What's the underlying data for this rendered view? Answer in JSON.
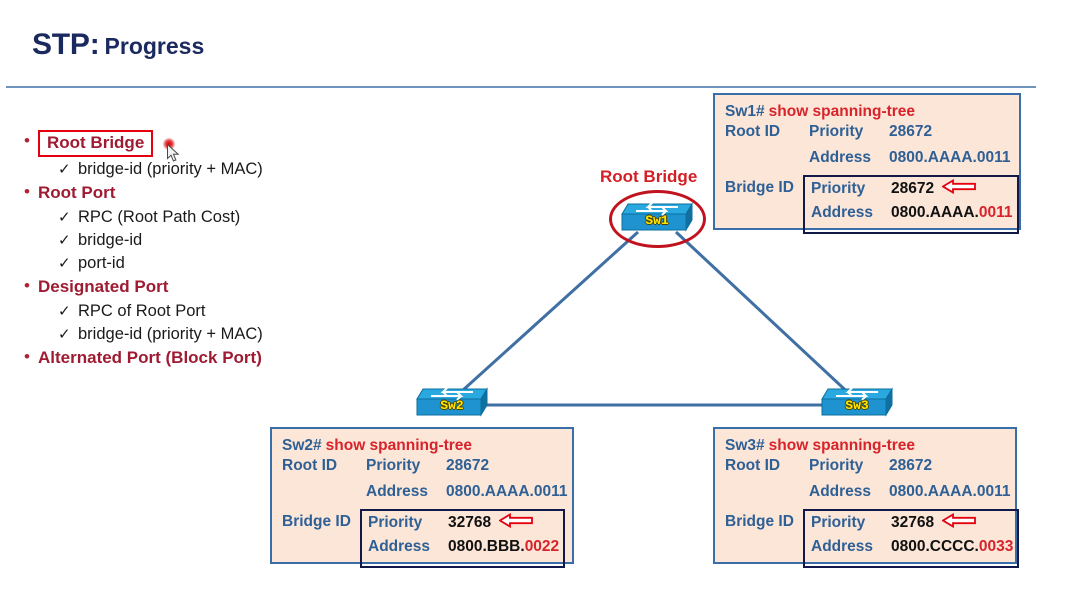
{
  "slide": {
    "title_main": "STP:",
    "title_sub": "Progress"
  },
  "bullets": [
    {
      "kind": "level1",
      "text": "Root Bridge",
      "boxed": true
    },
    {
      "kind": "level2",
      "text": "bridge-id (priority + MAC)"
    },
    {
      "kind": "level1",
      "text": "Root Port",
      "boxed": false
    },
    {
      "kind": "level2",
      "text": "RPC (Root Path Cost)"
    },
    {
      "kind": "level2",
      "text": "bridge-id"
    },
    {
      "kind": "level2",
      "text": "port-id"
    },
    {
      "kind": "level1",
      "text": "Designated Port",
      "boxed": false
    },
    {
      "kind": "level2",
      "text": "RPC of Root Port"
    },
    {
      "kind": "level2",
      "text": "bridge-id (priority + MAC)"
    },
    {
      "kind": "level1",
      "text": "Alternated Port (Block Port)",
      "boxed": false
    }
  ],
  "topology": {
    "root_bridge_label": "Root Bridge",
    "switches": [
      {
        "name": "Sw1"
      },
      {
        "name": "Sw2"
      },
      {
        "name": "Sw3"
      }
    ]
  },
  "panels": {
    "sw1": {
      "host": "Sw1#",
      "command": "show spanning-tree",
      "root_id_label": "Root ID",
      "bridge_id_label": "Bridge ID",
      "priority_label": "Priority",
      "address_label": "Address",
      "root_priority": "28672",
      "root_address": "0800.AAAA.0011",
      "bridge_priority": "28672",
      "bridge_address_main": "0800.AAAA.",
      "bridge_address_hl": "0011"
    },
    "sw2": {
      "host": "Sw2#",
      "command": "show spanning-tree",
      "root_id_label": "Root ID",
      "bridge_id_label": "Bridge ID",
      "priority_label": "Priority",
      "address_label": "Address",
      "root_priority": "28672",
      "root_address": "0800.AAAA.0011",
      "bridge_priority": "32768",
      "bridge_address_main": "0800.BBB.",
      "bridge_address_hl": "0022"
    },
    "sw3": {
      "host": "Sw3#",
      "command": "show spanning-tree",
      "root_id_label": "Root ID",
      "bridge_id_label": "Bridge ID",
      "priority_label": "Priority",
      "address_label": "Address",
      "root_priority": "28672",
      "root_address": "0800.AAAA.0011",
      "bridge_priority": "32768",
      "bridge_address_main": "0800.CCCC.",
      "bridge_address_hl": "0033"
    }
  },
  "colors": {
    "title": "#1b2a5e",
    "bullet_red": "#9e1b32",
    "panel_bg": "#fce6d8",
    "panel_border": "#3a6ea8",
    "label_blue": "#2e6096",
    "command_red": "#d8232a",
    "link_blue": "#3f6fa3",
    "switch_body": "#1f9ad6",
    "highlight_red": "#c1121f"
  }
}
